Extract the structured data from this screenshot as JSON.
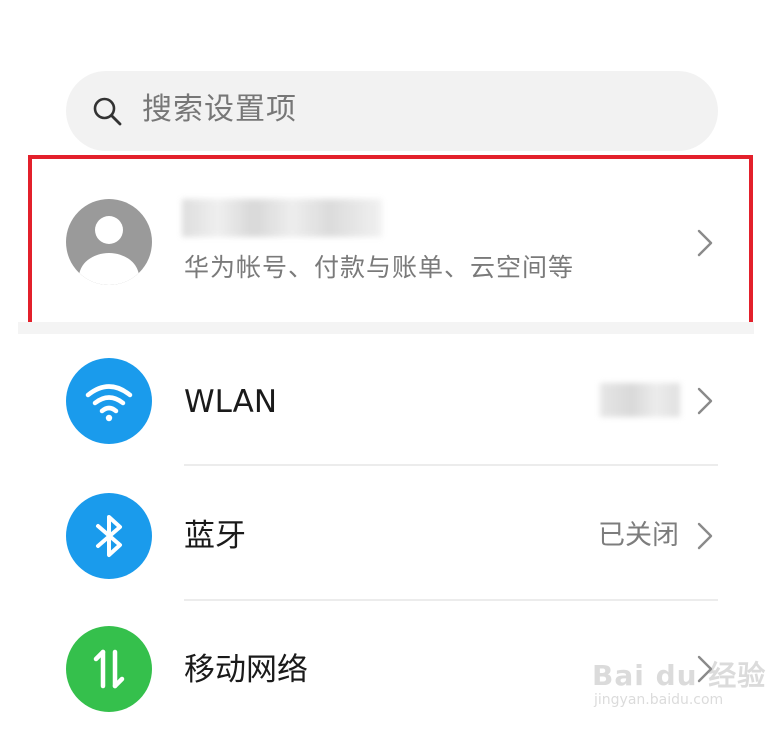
{
  "search": {
    "placeholder": "搜索设置项"
  },
  "account": {
    "subtitle": "华为帐号、付款与账单、云空间等",
    "highlight_color": "#e3202b"
  },
  "settings": {
    "wlan": {
      "label": "WLAN",
      "icon": "wifi-icon",
      "icon_color": "#1a9bec"
    },
    "bluetooth": {
      "label": "蓝牙",
      "status": "已关闭",
      "icon": "bluetooth-icon",
      "icon_color": "#1a9bec"
    },
    "mobile_network": {
      "label": "移动网络",
      "icon": "mobile-data-icon",
      "icon_color": "#35c04c"
    }
  },
  "watermark": {
    "main": "Bai du 经验",
    "sub": "jingyan.baidu.com"
  }
}
